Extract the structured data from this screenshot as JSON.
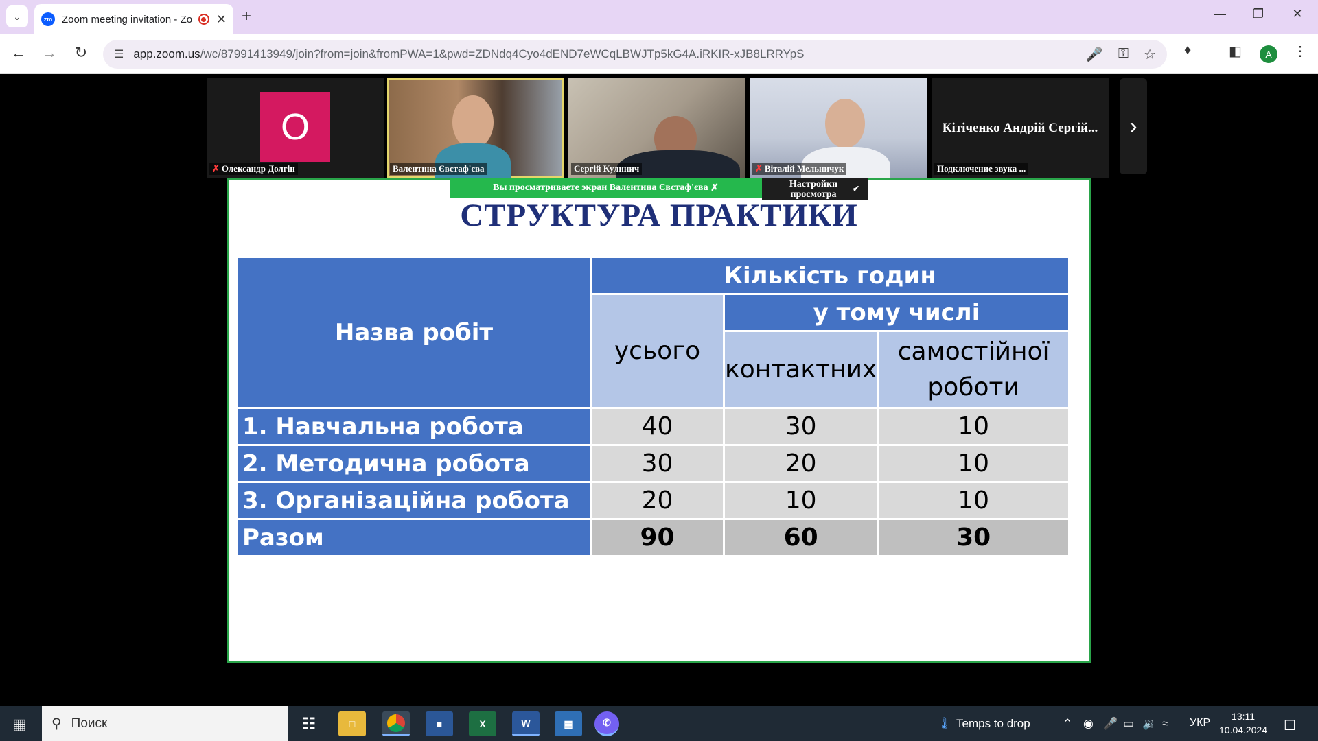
{
  "browser": {
    "tab_title": "Zoom meeting invitation - Zoom",
    "favicon_text": "zm",
    "url_host": "app.zoom.us",
    "url_path": "/wc/87991413949/join?from=join&fromPWA=1&pwd=ZDNdq4Cyo4dEND7eWCqLBWJTp5kG4A.iRKIR-xJB8LRRYpS",
    "profile_initial": "A"
  },
  "participants": [
    {
      "name": "Олександр Долгін",
      "initial": "O",
      "muted": true
    },
    {
      "name": "Валентина Євстаф'єва",
      "muted": false
    },
    {
      "name": "Сергій Кулинич",
      "muted": false
    },
    {
      "name": "Віталій Мельничук",
      "muted": true
    },
    {
      "name": "Кітіченко Андрій Сергій...",
      "status": "Подключение звука ..."
    }
  ],
  "share": {
    "banner": "Вы просматриваете экран  Валентина Євстаф'єва",
    "view_settings": "Настройки просмотра"
  },
  "slide": {
    "title": "СТРУКТУРА ПРАКТИКИ",
    "headers": {
      "name": "Назва робіт",
      "hours": "Кількість годин",
      "total": "усього",
      "including": "у тому числі",
      "contact": "контактних",
      "independent": "самостійної роботи"
    },
    "rows": [
      {
        "label": "1. Навчальна робота",
        "total": "40",
        "contact": "30",
        "independent": "10"
      },
      {
        "label": "2. Методична робота",
        "total": "30",
        "contact": "20",
        "independent": "10"
      },
      {
        "label": "3. Організаційна робота",
        "total": "20",
        "contact": "10",
        "independent": "10"
      }
    ],
    "sum": {
      "label": "Разом",
      "total": "90",
      "contact": "60",
      "independent": "30"
    }
  },
  "taskbar": {
    "search_placeholder": "Поиск",
    "weather": "Temps to drop",
    "language": "УКР",
    "time": "13:11",
    "date": "10.04.2024"
  }
}
